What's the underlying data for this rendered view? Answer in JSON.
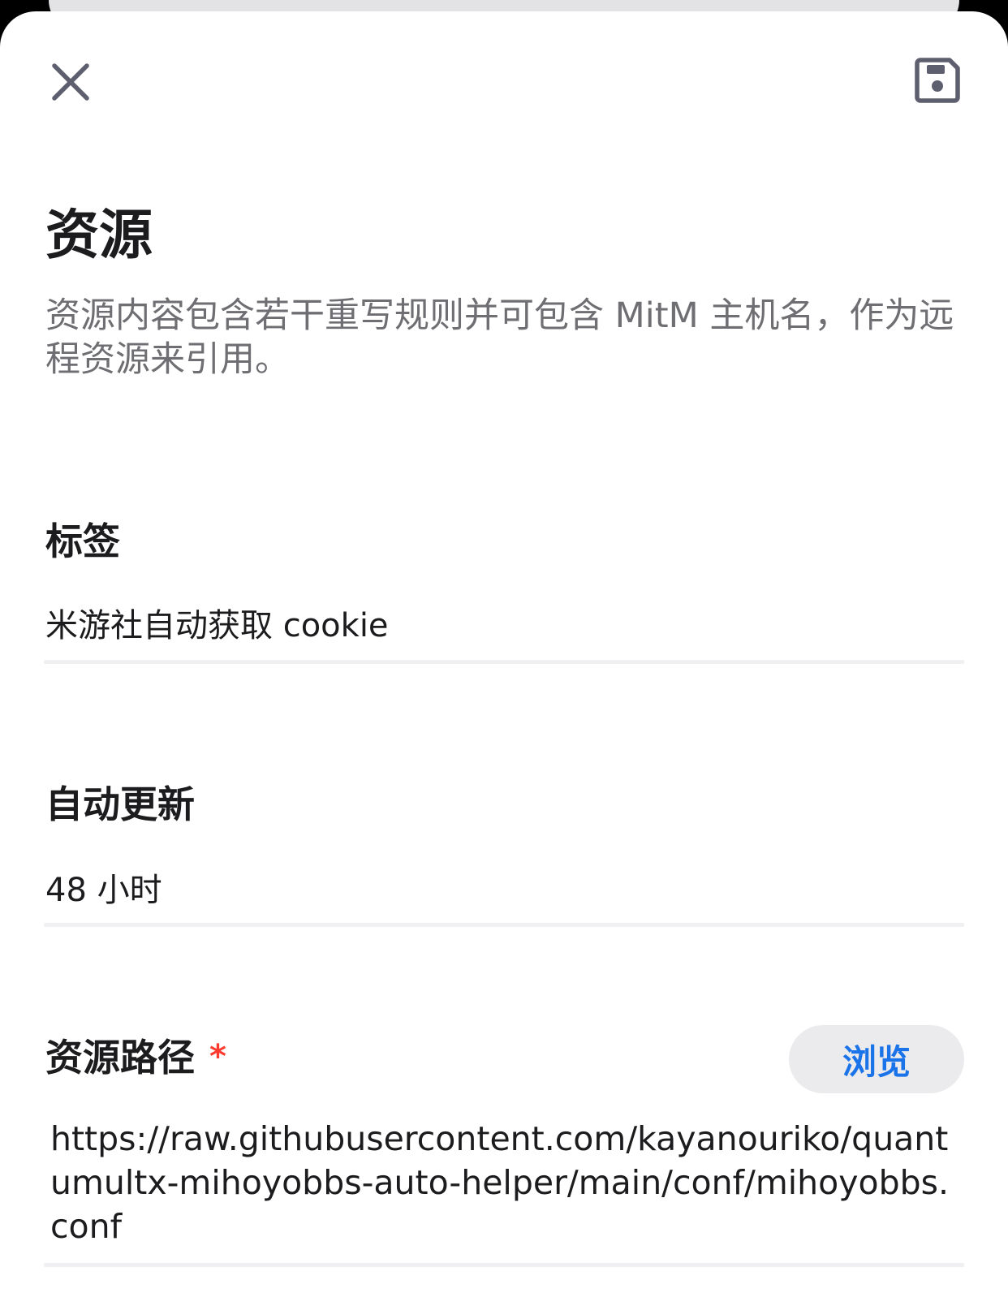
{
  "header": {
    "close_icon": "close-icon",
    "save_icon": "save-icon"
  },
  "page": {
    "title": "资源",
    "description": "资源内容包含若干重写规则并可包含 MitM 主机名，作为远程资源来引用。"
  },
  "fields": {
    "tag": {
      "label": "标签",
      "value": "米游社自动获取 cookie"
    },
    "auto_update": {
      "label": "自动更新",
      "value": "48 小时"
    },
    "resource_path": {
      "label": "资源路径",
      "required_mark": "*",
      "browse_label": "浏览",
      "value": "https://raw.githubusercontent.com/kayanouriko/quantumultx-mihoyobbs-auto-helper/main/conf/mihoyobbs.conf"
    }
  },
  "colors": {
    "accent": "#1a73e8",
    "required": "#ff3b30",
    "icon": "#5d5f6e"
  }
}
